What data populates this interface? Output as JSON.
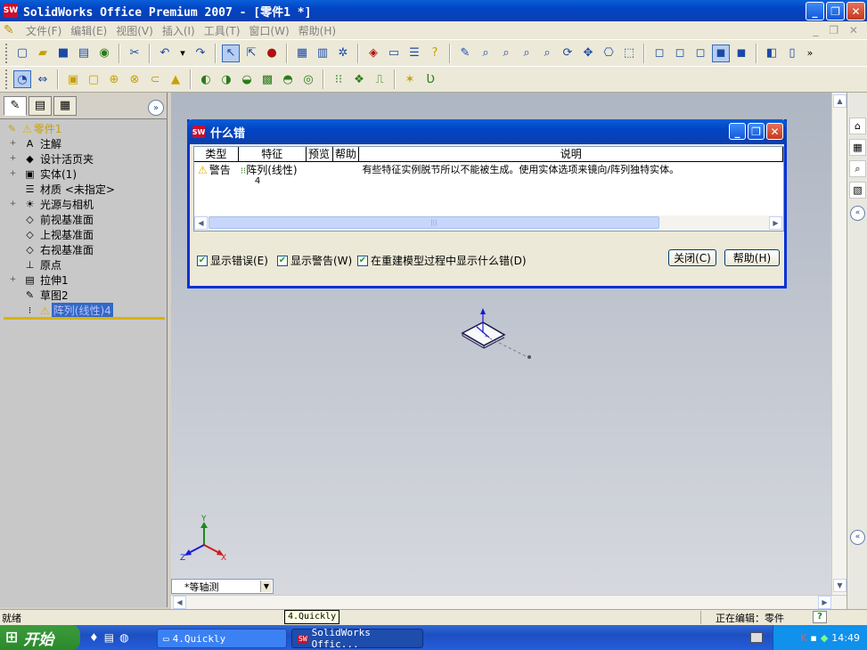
{
  "app": {
    "title": "SolidWorks Office Premium 2007 - [零件1 *]",
    "icon_text": "SW",
    "window_buttons": [
      "_",
      "❐",
      "✕"
    ]
  },
  "menu": {
    "items": [
      "文件(F)",
      "编辑(E)",
      "视图(V)",
      "插入(I)",
      "工具(T)",
      "窗口(W)",
      "帮助(H)"
    ],
    "right_controls": "_ ❐ ✕"
  },
  "feature_manager": {
    "root": "零件1",
    "items": [
      {
        "label": "注解",
        "icon": "A",
        "expand": "+"
      },
      {
        "label": "设计活页夹",
        "icon": "◆",
        "expand": "+"
      },
      {
        "label": "实体(1)",
        "icon": "▣",
        "expand": "+"
      },
      {
        "label": "材质 <未指定>",
        "icon": "☰",
        "expand": ""
      },
      {
        "label": "光源与相机",
        "icon": "☀",
        "expand": "+"
      },
      {
        "label": "前视基准面",
        "icon": "◇",
        "expand": ""
      },
      {
        "label": "上视基准面",
        "icon": "◇",
        "expand": ""
      },
      {
        "label": "右视基准面",
        "icon": "◇",
        "expand": ""
      },
      {
        "label": "原点",
        "icon": "⊥",
        "expand": ""
      },
      {
        "label": "拉伸1",
        "icon": "▤",
        "expand": "+"
      },
      {
        "label": "草图2",
        "icon": "✎",
        "expand": ""
      },
      {
        "label": "阵列(线性)4",
        "icon": "⁝",
        "expand": "",
        "selected": true
      }
    ],
    "collapse_icon": "»"
  },
  "dialog": {
    "title": "什么错",
    "columns": [
      "类型",
      "特征",
      "预览",
      "帮助",
      "说明"
    ],
    "rows": [
      {
        "type": "警告",
        "feature": "阵列(线性)",
        "feature_sub": "4",
        "preview": "",
        "help": "",
        "description": "有些特征实例脱节所以不能被生成。使用实体选项来镜向/阵列独特实体。"
      }
    ],
    "checkboxes": [
      {
        "label": "显示错误(E)",
        "checked": true
      },
      {
        "label": "显示警告(W)",
        "checked": true
      },
      {
        "label": "在重建模型过程中显示什么错(D)",
        "checked": true
      }
    ],
    "close_label": "关闭(C)",
    "help_label": "帮助(H)"
  },
  "view": {
    "orientation": "*等轴测",
    "triad": {
      "x": "X",
      "y": "Y",
      "z": "Z"
    }
  },
  "status": {
    "left": "就绪",
    "tooltip": "4.Quickly",
    "editing": "正在编辑：零件",
    "help": "?"
  },
  "taskbar": {
    "start": "开始",
    "tasks": [
      "4.Quickly",
      "SolidWorks Offic..."
    ],
    "clock": "14:49"
  },
  "colors": {
    "accent": "#0a3fae",
    "selection": "#316ac5",
    "warning": "#e0b000",
    "viewport_top": "#aeb6c3"
  }
}
